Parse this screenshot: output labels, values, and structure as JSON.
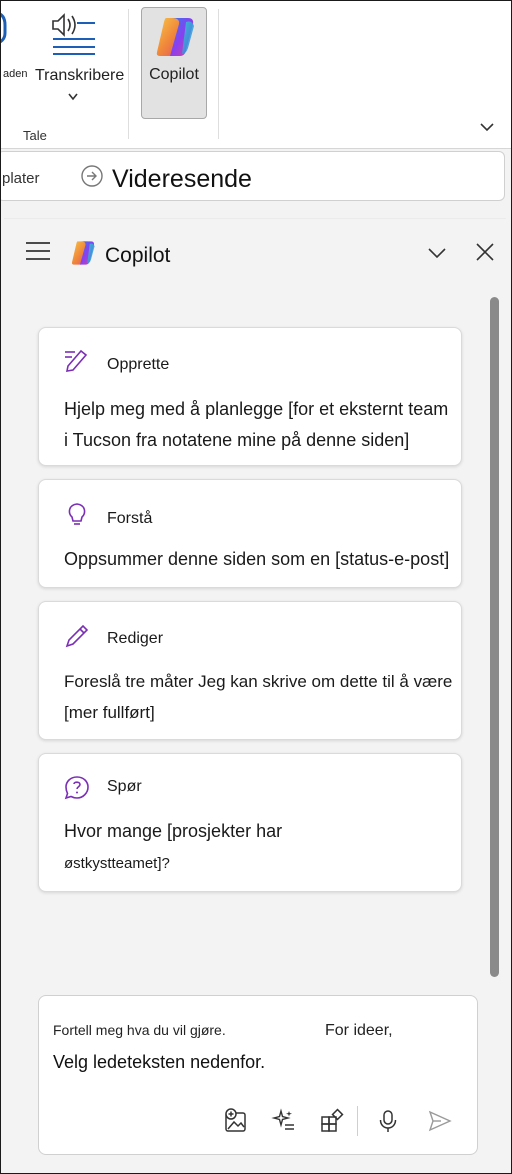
{
  "ribbon": {
    "partial_label": "aden",
    "transcribe_label": "Transkribere",
    "group_label": "Tale",
    "copilot_label": "Copilot"
  },
  "strip": {
    "templates_label": "plater",
    "forward_label": "Videresende"
  },
  "pane": {
    "title": "Copilot"
  },
  "cards": [
    {
      "title": "Opprette",
      "text": "Hjelp meg med å planlegge [for et eksternt team i Tucson fra notatene mine på denne siden]",
      "icon": "pen-create-icon"
    },
    {
      "title": "Forstå",
      "text": "Oppsummer denne siden som en [status-e-post]",
      "icon": "lightbulb-icon"
    },
    {
      "title": "Rediger",
      "text": "Foreslå tre måter   Jeg kan skrive om dette til å være [mer fullført]",
      "icon": "pencil-icon"
    },
    {
      "title": "Spør",
      "text_line1": "Hvor mange [prosjekter har",
      "text_line2": "østkystteamet]?",
      "icon": "question-bubble-icon"
    }
  ],
  "input": {
    "hint_left": "Fortell meg hva du vil gjøre.",
    "hint_right": "For ideer,",
    "main_text": "Velg ledeteksten nedenfor."
  },
  "colors": {
    "accent_purple": "#7b2fb5",
    "pane_bg": "#f3f3f3",
    "button_active_bg": "#e2e2e2"
  }
}
